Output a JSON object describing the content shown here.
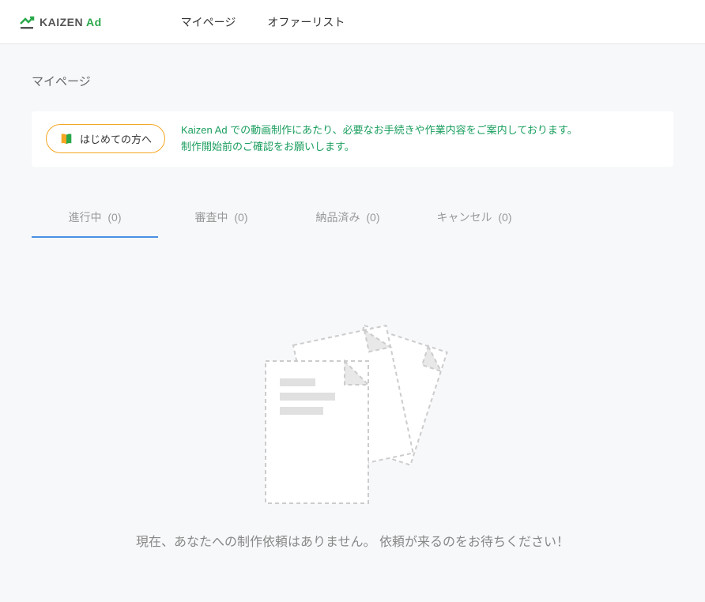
{
  "header": {
    "logo": {
      "text_main": "KAIZEN",
      "text_accent": "Ad"
    },
    "nav": [
      {
        "label": "マイページ"
      },
      {
        "label": "オファーリスト"
      }
    ]
  },
  "page": {
    "title": "マイページ"
  },
  "notice": {
    "button_label": "はじめての方へ",
    "text_line1": "Kaizen Ad での動画制作にあたり、必要なお手続きや作業内容をご案内しております。",
    "text_line2": "制作開始前のご確認をお願いします。"
  },
  "tabs": [
    {
      "label": "進行中",
      "count": "(0)",
      "active": true
    },
    {
      "label": "審査中",
      "count": "(0)",
      "active": false
    },
    {
      "label": "納品済み",
      "count": "(0)",
      "active": false
    },
    {
      "label": "キャンセル",
      "count": "(0)",
      "active": false
    }
  ],
  "empty": {
    "message": "現在、あなたへの制作依頼はありません。 依頼が来るのをお待ちください！"
  }
}
